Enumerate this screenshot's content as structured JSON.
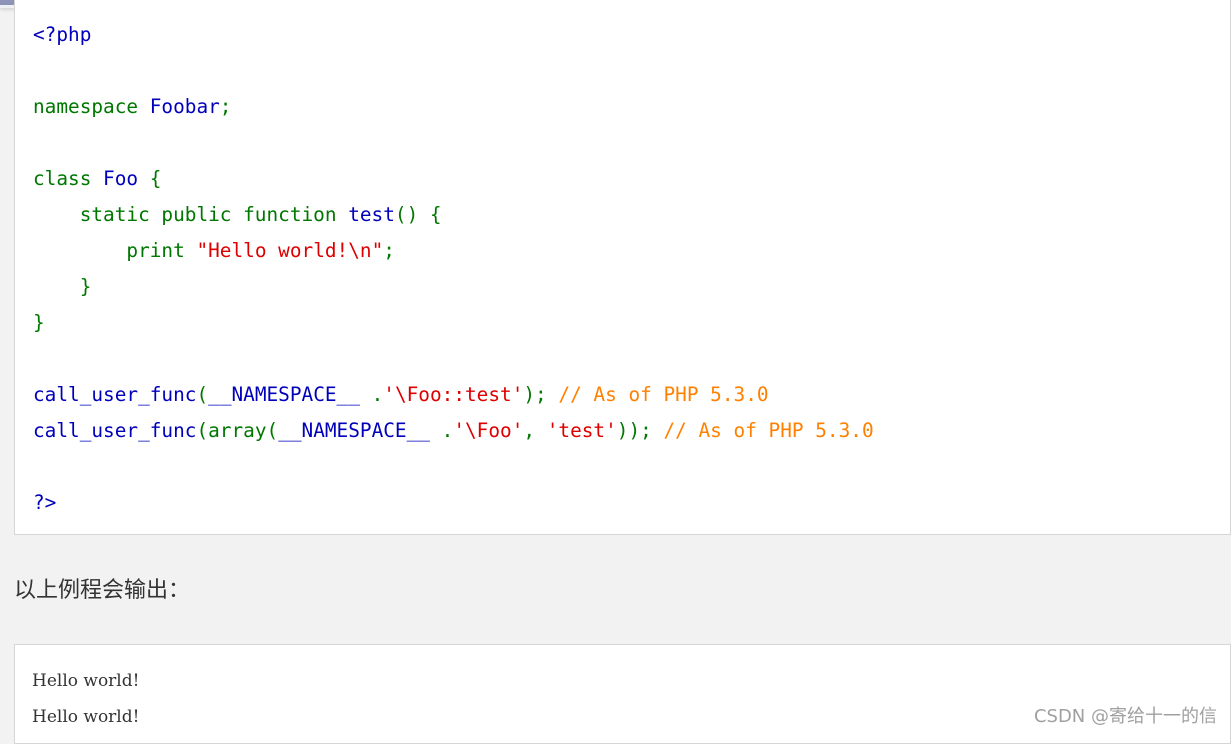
{
  "code_lines": [
    [
      {
        "c": "df",
        "t": "<?php"
      }
    ],
    [],
    [
      {
        "c": "kw",
        "t": "namespace "
      },
      {
        "c": "df",
        "t": "Foobar"
      },
      {
        "c": "kw",
        "t": ";"
      }
    ],
    [],
    [
      {
        "c": "kw",
        "t": "class "
      },
      {
        "c": "df",
        "t": "Foo "
      },
      {
        "c": "kw",
        "t": "{"
      }
    ],
    [
      {
        "c": "kw",
        "t": "    static public function "
      },
      {
        "c": "df",
        "t": "test"
      },
      {
        "c": "kw",
        "t": "() {"
      }
    ],
    [
      {
        "c": "kw",
        "t": "        print "
      },
      {
        "c": "st",
        "t": "\"Hello world!\\n\""
      },
      {
        "c": "kw",
        "t": ";"
      }
    ],
    [
      {
        "c": "kw",
        "t": "    }"
      }
    ],
    [
      {
        "c": "kw",
        "t": "}"
      }
    ],
    [],
    [
      {
        "c": "df",
        "t": "call_user_func"
      },
      {
        "c": "kw",
        "t": "("
      },
      {
        "c": "df",
        "t": "__NAMESPACE__ "
      },
      {
        "c": "kw",
        "t": "."
      },
      {
        "c": "st",
        "t": "'\\Foo::test'"
      },
      {
        "c": "kw",
        "t": "); "
      },
      {
        "c": "cm",
        "t": "// As of PHP 5.3.0"
      }
    ],
    [
      {
        "c": "df",
        "t": "call_user_func"
      },
      {
        "c": "kw",
        "t": "(array("
      },
      {
        "c": "df",
        "t": "__NAMESPACE__ "
      },
      {
        "c": "kw",
        "t": "."
      },
      {
        "c": "st",
        "t": "'\\Foo'"
      },
      {
        "c": "kw",
        "t": ", "
      },
      {
        "c": "st",
        "t": "'test'"
      },
      {
        "c": "kw",
        "t": ")); "
      },
      {
        "c": "cm",
        "t": "// As of PHP 5.3.0"
      }
    ],
    [],
    [
      {
        "c": "df",
        "t": "?>"
      }
    ]
  ],
  "caption": "以上例程会输出：",
  "output_lines": [
    "Hello world!",
    "Hello world!"
  ],
  "watermark": "CSDN @寄给十一的信",
  "colors": {
    "keyword": "#007700",
    "default": "#0000bb",
    "string": "#dd0000",
    "comment": "#ff8000"
  }
}
